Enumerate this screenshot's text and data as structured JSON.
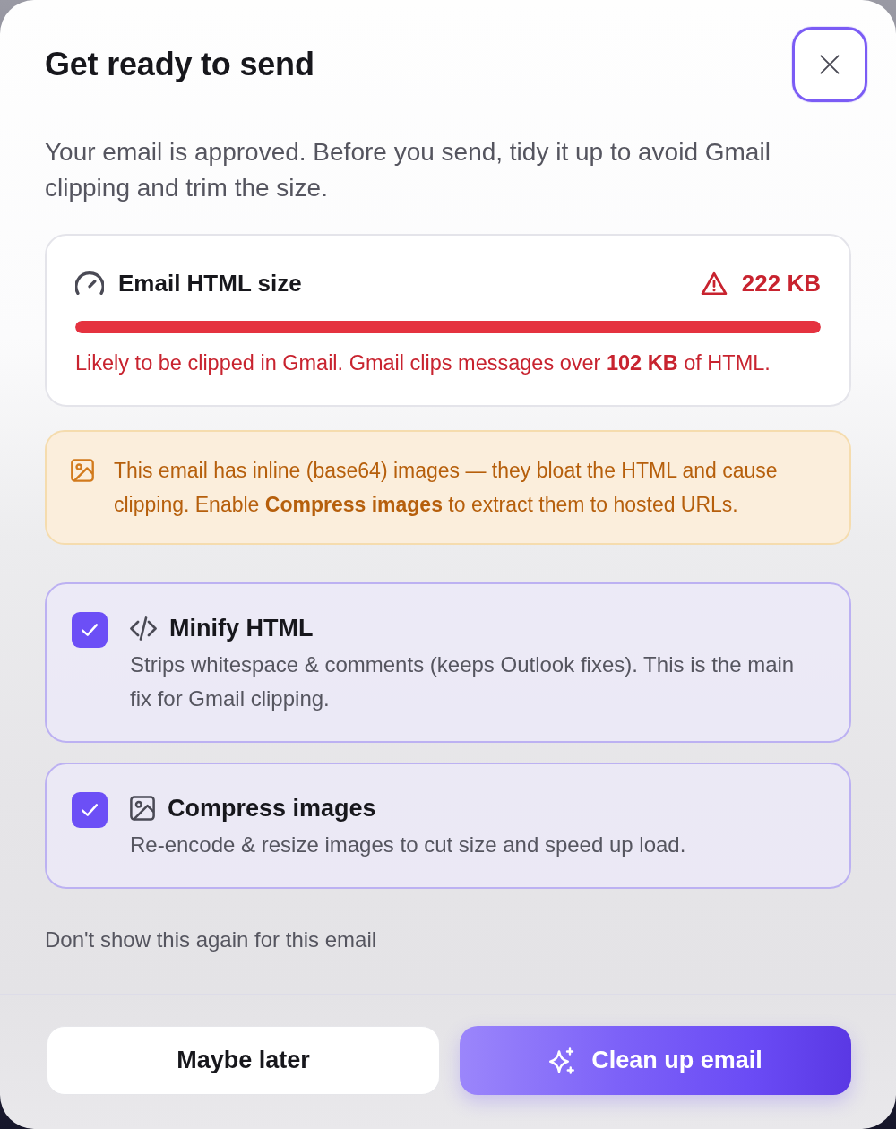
{
  "dialog": {
    "title": "Get ready to send",
    "description": "Your email is approved. Before you send, tidy it up to avoid Gmail clipping and trim the size."
  },
  "size_card": {
    "label": "Email HTML size",
    "value": "222 KB",
    "over_limit": true,
    "level": 1,
    "message": "Likely to be clipped in Gmail. Gmail clips messages over **102 KB** of HTML."
  },
  "warning": {
    "text": "This email has inline (base64) images — they bloat the HTML and cause clipping. Enable **Compress images** to extract them to hosted URLs."
  },
  "options": [
    {
      "kind": "code",
      "title": "Minify HTML",
      "description": "Strips whitespace & comments (keeps Outlook fixes). This is the main fix for Gmail clipping.",
      "checked": true
    },
    {
      "kind": "image",
      "title": "Compress images",
      "description": "Re-encode & resize images to cut size and speed up load.",
      "checked": true
    }
  ],
  "dont_show_again": "Don't show this again for this email",
  "buttons": [
    {
      "kind": "secondary",
      "label": "Maybe later"
    },
    {
      "kind": "primary",
      "label": "Clean up email"
    }
  ]
}
